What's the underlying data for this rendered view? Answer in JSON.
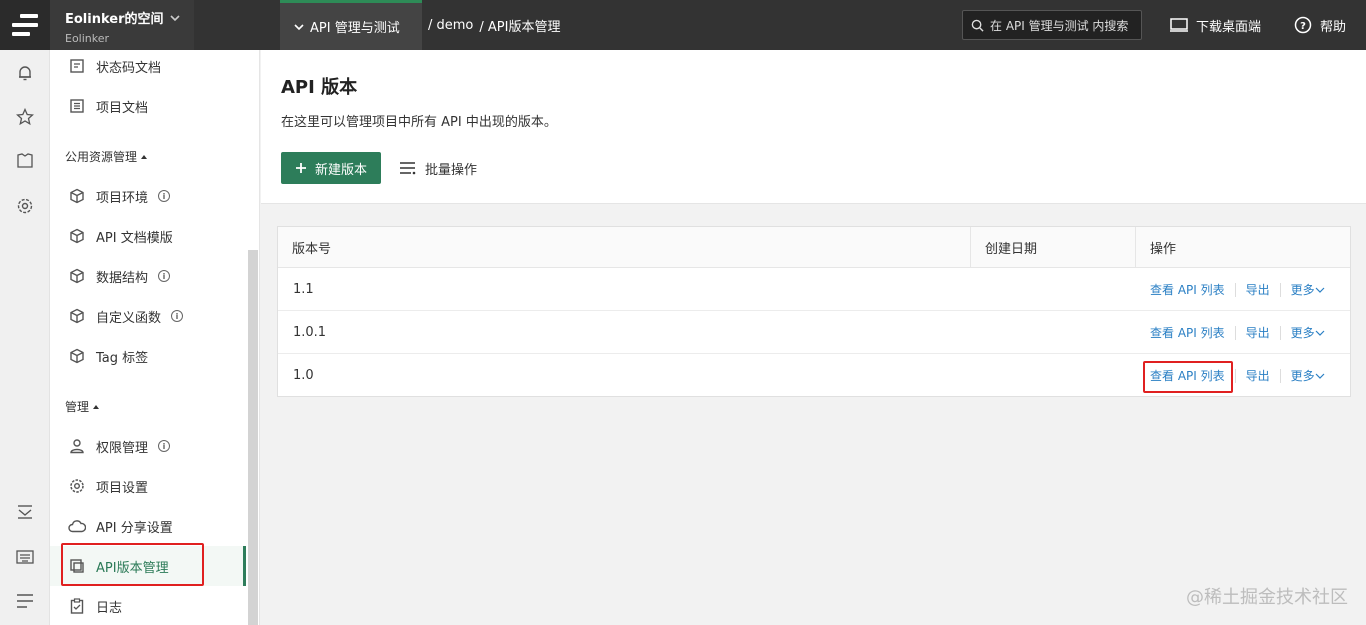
{
  "topbar": {
    "workspace_name": "Eolinker的空间",
    "workspace_sub": "Eolinker",
    "project_tab": "API 管理与测试",
    "breadcrumb": [
      "/ demo",
      "/ API版本管理"
    ],
    "search_placeholder": "在 API 管理与测试 内搜索",
    "download_label": "下载桌面端",
    "help_label": "帮助"
  },
  "sidebar": {
    "items_top": [
      {
        "label": "状态码文档",
        "icon": "doc-icon"
      },
      {
        "label": "项目文档",
        "icon": "list-doc-icon"
      }
    ],
    "section_public": "公用资源管理",
    "items_public": [
      {
        "label": "项目环境",
        "icon": "cube-icon",
        "info": true
      },
      {
        "label": "API 文档模版",
        "icon": "cube-icon",
        "info": false
      },
      {
        "label": "数据结构",
        "icon": "cube-icon",
        "info": true
      },
      {
        "label": "自定义函数",
        "icon": "cube-icon",
        "info": true
      },
      {
        "label": "Tag 标签",
        "icon": "cube-icon",
        "info": false
      }
    ],
    "section_manage": "管理",
    "items_manage": [
      {
        "label": "权限管理",
        "icon": "user-icon",
        "info": true
      },
      {
        "label": "项目设置",
        "icon": "gear-icon",
        "info": false
      },
      {
        "label": "API 分享设置",
        "icon": "cloud-icon",
        "info": false
      },
      {
        "label": "API版本管理",
        "icon": "copy-icon",
        "info": false,
        "active": true
      },
      {
        "label": "日志",
        "icon": "clipboard-icon",
        "info": false
      }
    ]
  },
  "main": {
    "title": "API 版本",
    "description": "在这里可以管理项目中所有 API 中出现的版本。",
    "new_button": "新建版本",
    "batch_button": "批量操作",
    "table": {
      "headers": [
        "版本号",
        "创建日期",
        "操作"
      ],
      "rows": [
        {
          "version": "1.1"
        },
        {
          "version": "1.0.1"
        },
        {
          "version": "1.0"
        }
      ],
      "op_view": "查看 API 列表",
      "op_export": "导出",
      "op_more": "更多"
    }
  },
  "watermark": "@稀土掘金技术社区"
}
